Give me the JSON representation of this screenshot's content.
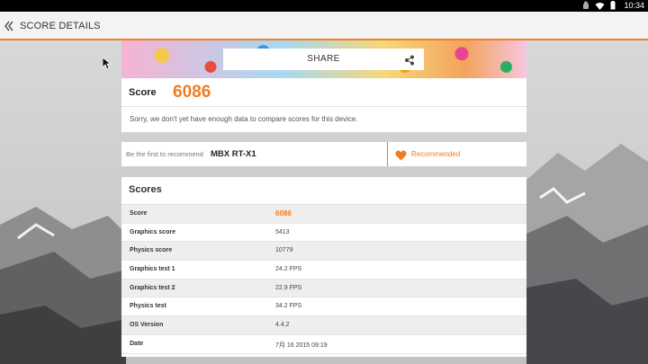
{
  "status_bar": {
    "time": "10:34",
    "icons": [
      "android-icon",
      "wifi-icon",
      "battery-icon"
    ]
  },
  "action_bar": {
    "title": "SCORE DETAILS",
    "back_icon": "back-chevron-icon"
  },
  "share": {
    "label": "SHARE",
    "icon": "share-icon"
  },
  "score": {
    "label": "Score",
    "value": "6086",
    "message": "Sorry, we don't yet have enough data to compare scores for this device."
  },
  "recommend": {
    "hint": "Be the first to recommend",
    "device": "MBX RT-X1",
    "label": "Recommended",
    "icon": "heart-icon"
  },
  "scores": {
    "title": "Scores",
    "rows": [
      {
        "key": "Score",
        "value": "6086"
      },
      {
        "key": "Graphics score",
        "value": "5413"
      },
      {
        "key": "Physics score",
        "value": "10779"
      },
      {
        "key": "Graphics test 1",
        "value": "24.2 FPS"
      },
      {
        "key": "Graphics test 2",
        "value": "22.9 FPS"
      },
      {
        "key": "Physics test",
        "value": "34.2 FPS"
      },
      {
        "key": "OS Version",
        "value": "4.4.2"
      },
      {
        "key": "Date",
        "value": "7月 16 2015 09:19"
      }
    ]
  },
  "colors": {
    "accent": "#f07d21",
    "statusbar": "#000000",
    "actionbar": "#f3f3f3"
  }
}
